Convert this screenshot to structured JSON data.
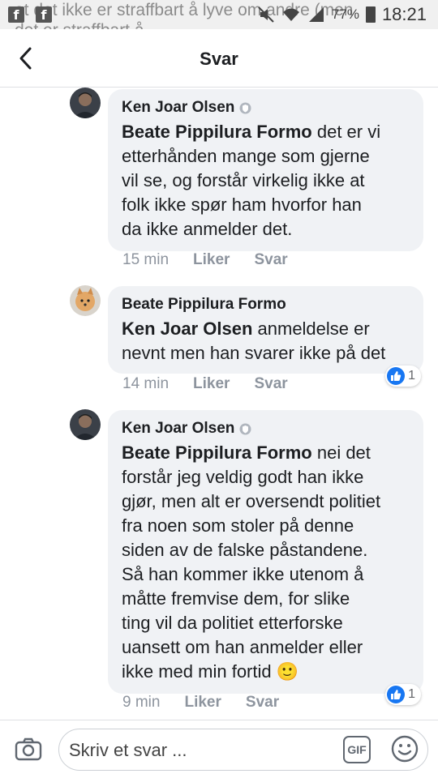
{
  "status_bar": {
    "background_text_line1": "at det ikke er straffbart å lyve om andre (men",
    "background_text_line2": "det er straffbart å ...",
    "app_icons": [
      "f",
      "f"
    ],
    "battery": "77%",
    "time": "18:21"
  },
  "header": {
    "title": "Svar"
  },
  "comments": [
    {
      "author": "Ken Joar Olsen",
      "has_badge": true,
      "mention": "Beate Pippilura Formo",
      "text_lines": [
        "det er vi",
        "etterhånden mange som gjerne",
        "vil se, og forstår virkelig ikke at",
        "folk ikke spør ham hvorfor han",
        "da ikke anmelder det."
      ],
      "time": "15 min",
      "like_label": "Liker",
      "reply_label": "Svar"
    },
    {
      "author": "Beate Pippilura Formo",
      "has_badge": false,
      "mention": "Ken Joar Olsen",
      "text_lines": [
        "anmeldelse er",
        "nevnt men han svarer ikke på det"
      ],
      "time": "14 min",
      "like_label": "Liker",
      "reply_label": "Svar",
      "reactions": "1"
    },
    {
      "author": "Ken Joar Olsen",
      "has_badge": true,
      "mention": "Beate Pippilura Formo",
      "text_lines": [
        "nei det",
        "forstår jeg veldig godt han ikke",
        "gjør, men alt er oversendt politiet",
        "fra noen som stoler på denne",
        "siden av de falske påstandene.",
        "Så han kommer ikke utenom å",
        "måtte fremvise dem, for slike",
        "ting vil da politiet etterforske",
        "uansett om han anmelder eller",
        "ikke med min fortid 🙂"
      ],
      "time": "9 min",
      "like_label": "Liker",
      "reply_label": "Svar",
      "reactions": "1"
    }
  ],
  "composer": {
    "placeholder": "Skriv et svar ...",
    "gif_label": "GIF"
  },
  "colors": {
    "bubble": "#f0f2f5",
    "meta": "#8d949e",
    "like_blue": "#1877f2"
  }
}
